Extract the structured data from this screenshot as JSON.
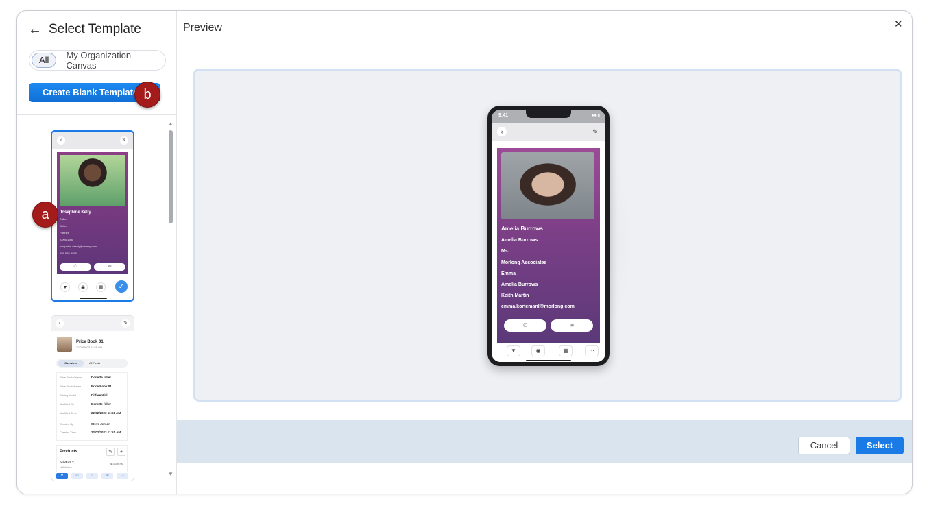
{
  "header": {
    "title": "Select Template"
  },
  "filter": {
    "all": "All",
    "org": "My Organization Canvas"
  },
  "create_button": "Create Blank Template",
  "markers": {
    "a": "a",
    "b": "b"
  },
  "template1": {
    "name": "Josephine Kelly",
    "lines": [
      "Zoller",
      "Soller",
      "Partner",
      "22/04/1980",
      "josephine.daekly@crossy.com",
      "555-555-5555"
    ]
  },
  "template2": {
    "title": "Price Book 01",
    "date": "22/02/2023 11:51 AM",
    "tabs": [
      "Overview",
      "All Fields"
    ],
    "fields": [
      {
        "label": "Price Book Owner",
        "value": "Donette foller"
      },
      {
        "label": "Price Book Name",
        "value": "Price Book 01"
      },
      {
        "label": "Pricing Model",
        "value": "Differential"
      },
      {
        "label": "Modified By",
        "value": "Donette foller"
      },
      {
        "label": "Modified Time",
        "value": "22/02/2023 11:51 AM"
      },
      {
        "label": "Created By",
        "value": "Steve Jerson"
      },
      {
        "label": "Created Time",
        "value": "22/02/2023 11:51 AM"
      }
    ],
    "products": {
      "title": "Products",
      "name": "product 3",
      "sub": "N/A     Active",
      "price": "$ 3,000.00"
    }
  },
  "preview": {
    "title": "Preview",
    "time": "9:41",
    "name": "Amelia Burrows",
    "lines": [
      "Amelia Burrows",
      "Ms.",
      "Morlong Associates",
      "Emma",
      "Amelia Burrows",
      "Keith Martin",
      "emma.kortemanl@morlong.com"
    ]
  },
  "footer": {
    "cancel": "Cancel",
    "select": "Select"
  },
  "colors": {
    "accent": "#1a7be7",
    "card_top": "#9c4b96",
    "card_bottom": "#5b3979",
    "marker": "#a31b1b"
  }
}
